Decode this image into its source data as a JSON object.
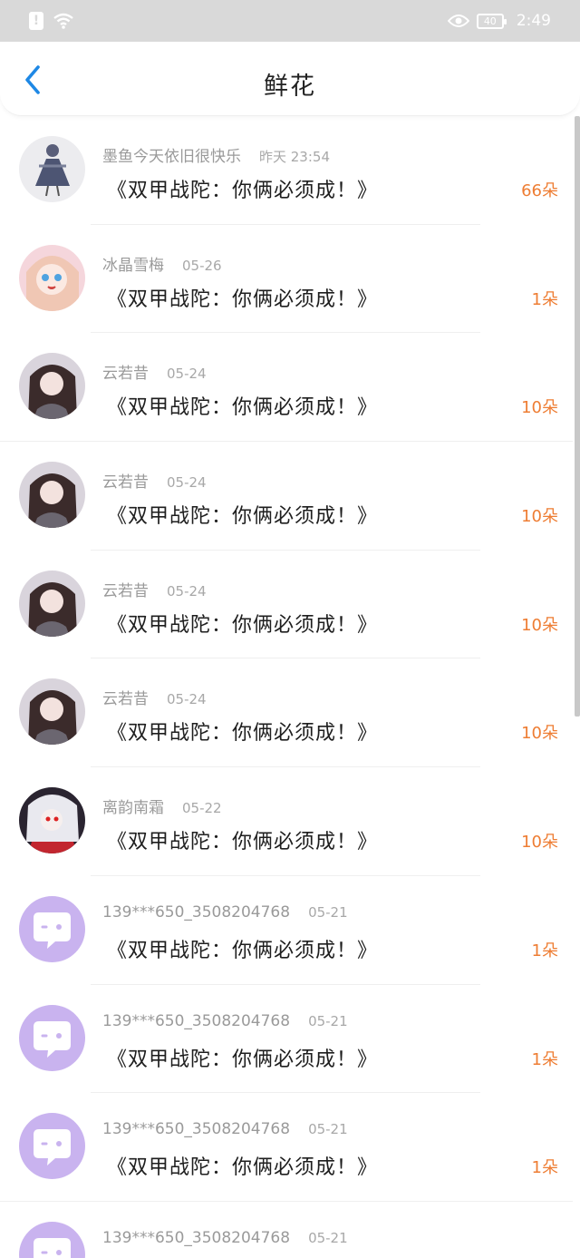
{
  "status": {
    "time": "2:49",
    "battery": "40"
  },
  "header": {
    "title": "鲜花"
  },
  "colors": {
    "accent": "#1e88e5",
    "count": "#ee7d33",
    "default_avatar": "#c9b3ef"
  },
  "rows": [
    {
      "name": "墨鱼今天依旧很快乐",
      "time": "昨天 23:54",
      "message": "《双甲战陀：你俩必须成！》",
      "count": "66朵"
    },
    {
      "name": "冰晶雪梅",
      "time": "05-26",
      "message": "《双甲战陀：你俩必须成！》",
      "count": "1朵"
    },
    {
      "name": "云若昔",
      "time": "05-24",
      "message": "《双甲战陀：你俩必须成！》",
      "count": "10朵"
    },
    {
      "name": "云若昔",
      "time": "05-24",
      "message": "《双甲战陀：你俩必须成！》",
      "count": "10朵"
    },
    {
      "name": "云若昔",
      "time": "05-24",
      "message": "《双甲战陀：你俩必须成！》",
      "count": "10朵"
    },
    {
      "name": "云若昔",
      "time": "05-24",
      "message": "《双甲战陀：你俩必须成！》",
      "count": "10朵"
    },
    {
      "name": "离韵南霜",
      "time": "05-22",
      "message": "《双甲战陀：你俩必须成！》",
      "count": "10朵"
    },
    {
      "name": "139***650_3508204768",
      "time": "05-21",
      "message": "《双甲战陀：你俩必须成！》",
      "count": "1朵"
    },
    {
      "name": "139***650_3508204768",
      "time": "05-21",
      "message": "《双甲战陀：你俩必须成！》",
      "count": "1朵"
    },
    {
      "name": "139***650_3508204768",
      "time": "05-21",
      "message": "《双甲战陀：你俩必须成！》",
      "count": "1朵"
    },
    {
      "name": "139***650_3508204768",
      "time": "05-21",
      "message": "",
      "count": ""
    }
  ]
}
